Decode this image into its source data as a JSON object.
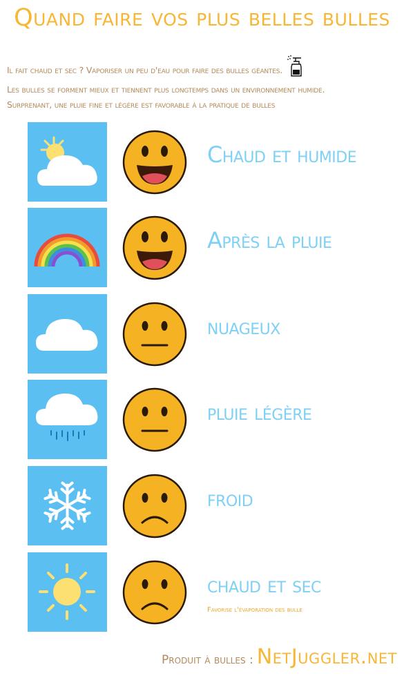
{
  "title": "Quand faire vos plus belles bulles",
  "intro": {
    "line1": "Il fait chaud et sec ? Vaporiser un peu d'eau pour faire des bulles géantes.",
    "line2": "Les bulles se forment mieux et tiennent plus longtemps dans  un environnement humide.",
    "line3": "Surprenant, une pluie fine et légère est favorable à la pratique de bulles"
  },
  "rows": [
    {
      "weather_icon": "sun-behind-cloud-icon",
      "mood": "very-happy",
      "label": "Chaud et humide"
    },
    {
      "weather_icon": "rainbow-icon",
      "mood": "very-happy",
      "label": "Après la pluie"
    },
    {
      "weather_icon": "cloud-icon",
      "mood": "neutral",
      "label": "nuageux"
    },
    {
      "weather_icon": "rain-cloud-icon",
      "mood": "neutral",
      "label": "pluie légère"
    },
    {
      "weather_icon": "snowflake-icon",
      "mood": "sad",
      "label": "froid"
    },
    {
      "weather_icon": "sun-icon",
      "mood": "sad",
      "label": "chaud et sec",
      "note": "Favorise l'évaporation des bulle"
    }
  ],
  "footer": {
    "prefix": "Produit à bulles :",
    "brand": "NetJuggler.net"
  },
  "colors": {
    "title": "#f7b734",
    "intro": "#b3895a",
    "label": "#7fd0f5",
    "tile": "#5bbff1",
    "face": "#f5b324"
  }
}
